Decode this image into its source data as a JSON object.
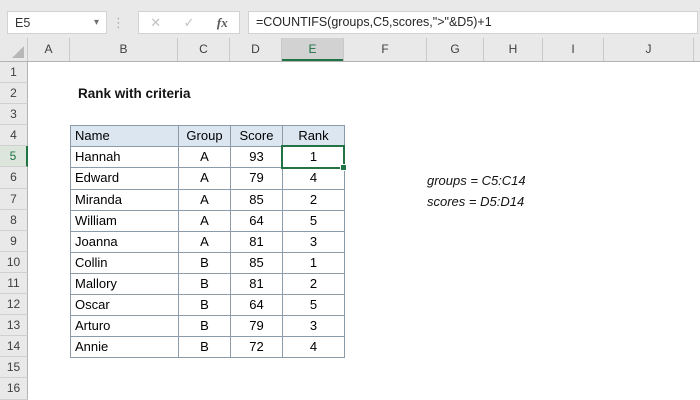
{
  "formula_bar": {
    "cell_reference": "E5",
    "cancel_glyph": "✕",
    "enter_glyph": "✓",
    "fx_glyph": "fx",
    "formula": "=COUNTIFS(groups,C5,scores,\">\"&D5)+1"
  },
  "sheet": {
    "column_letters": [
      "A",
      "B",
      "C",
      "D",
      "E",
      "F",
      "G",
      "H",
      "I",
      "J"
    ],
    "selected_column": "E",
    "row_numbers": [
      1,
      2,
      3,
      4,
      5,
      6,
      7,
      8,
      9,
      10,
      11,
      12,
      13,
      14,
      15,
      16
    ],
    "selected_row": 5,
    "selected_cell": "E5"
  },
  "title": "Rank with criteria",
  "table": {
    "headers": [
      "Name",
      "Group",
      "Score",
      "Rank"
    ],
    "rows": [
      [
        "Hannah",
        "A",
        "93",
        "1"
      ],
      [
        "Edward",
        "A",
        "79",
        "4"
      ],
      [
        "Miranda",
        "A",
        "85",
        "2"
      ],
      [
        "William",
        "A",
        "64",
        "5"
      ],
      [
        "Joanna",
        "A",
        "81",
        "3"
      ],
      [
        "Collin",
        "B",
        "85",
        "1"
      ],
      [
        "Mallory",
        "B",
        "81",
        "2"
      ],
      [
        "Oscar",
        "B",
        "64",
        "5"
      ],
      [
        "Arturo",
        "B",
        "79",
        "3"
      ],
      [
        "Annie",
        "B",
        "72",
        "4"
      ]
    ]
  },
  "annotations": [
    "groups = C5:C14",
    "scores = D5:D14"
  ],
  "colors": {
    "accent_green": "#217346",
    "table_header_fill": "#dce6f1",
    "table_border": "#8c9baa",
    "chrome_gray": "#e9e9e9"
  }
}
